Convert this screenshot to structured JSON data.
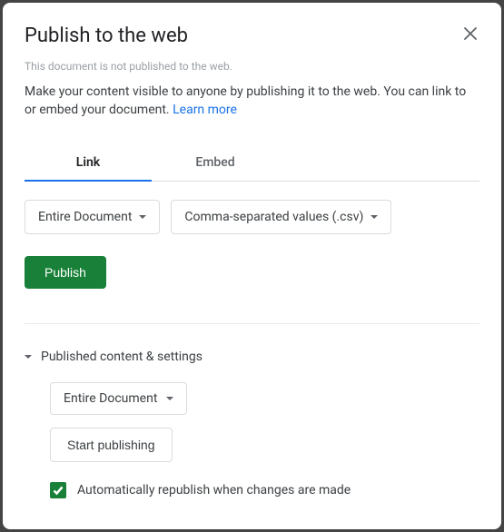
{
  "dialog": {
    "title": "Publish to the web",
    "status": "This document is not published to the web.",
    "description": "Make your content visible to anyone by publishing it to the web. You can link to or embed your document. ",
    "learn_more": "Learn more"
  },
  "tabs": {
    "link": "Link",
    "embed": "Embed"
  },
  "selectors": {
    "scope": "Entire Document",
    "format": "Comma-separated values (.csv)"
  },
  "buttons": {
    "publish": "Publish",
    "start_publishing": "Start publishing"
  },
  "settings": {
    "header": "Published content & settings",
    "scope": "Entire Document",
    "auto_republish": "Automatically republish when changes are made"
  }
}
